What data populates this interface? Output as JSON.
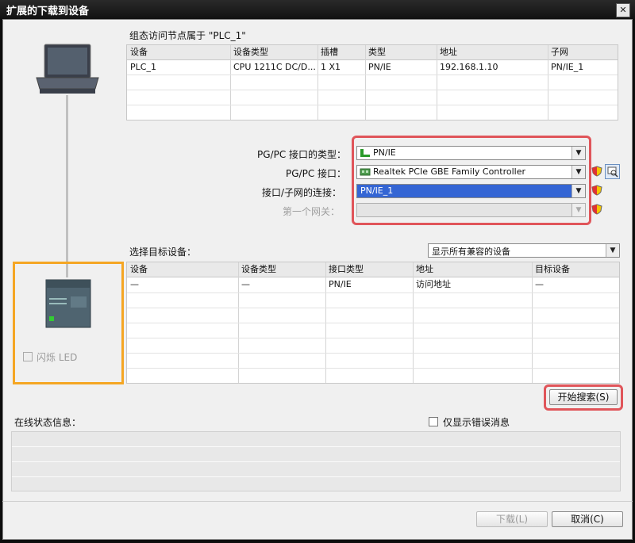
{
  "window": {
    "title": "扩展的下载到设备",
    "close_glyph": "✕"
  },
  "top_section": {
    "heading": "组态访问节点属于 \"PLC_1\"",
    "columns": [
      "设备",
      "设备类型",
      "插槽",
      "类型",
      "地址",
      "子网"
    ],
    "rows": [
      [
        "PLC_1",
        "CPU 1211C DC/D...",
        "1 X1",
        "PN/IE",
        "192.168.1.10",
        "PN/IE_1"
      ]
    ]
  },
  "interface": {
    "type_label": "PG/PC 接口的类型：",
    "type_value": "PN/IE",
    "iface_label": "PG/PC 接口：",
    "iface_value": "Realtek PCIe GBE Family Controller",
    "subnet_label": "接口/子网的连接：",
    "subnet_value": "PN/IE_1",
    "gateway_label": "第一个网关："
  },
  "target": {
    "label": "选择目标设备：",
    "filter_value": "显示所有兼容的设备",
    "columns": [
      "设备",
      "设备类型",
      "接口类型",
      "地址",
      "目标设备"
    ],
    "rows": [
      [
        "—",
        "—",
        "PN/IE",
        "访问地址",
        "—"
      ]
    ]
  },
  "flash_led_label": "闪烁 LED",
  "start_search_label": "开始搜索(S)",
  "status": {
    "label": "在线状态信息：",
    "only_errors_label": "仅显示错误消息"
  },
  "footer": {
    "load_label": "下载(L)",
    "cancel_label": "取消(C)"
  },
  "colors": {
    "highlight_red": "#e0555a",
    "highlight_orange": "#f5a623",
    "selection_blue": "#3465d4"
  },
  "icons": {
    "network": "network-icon",
    "adapter": "network-adapter-icon",
    "shield": "shield-icon",
    "diagnostics": "diagnostics-icon",
    "pc": "pc-icon",
    "plc": "plc-icon"
  }
}
